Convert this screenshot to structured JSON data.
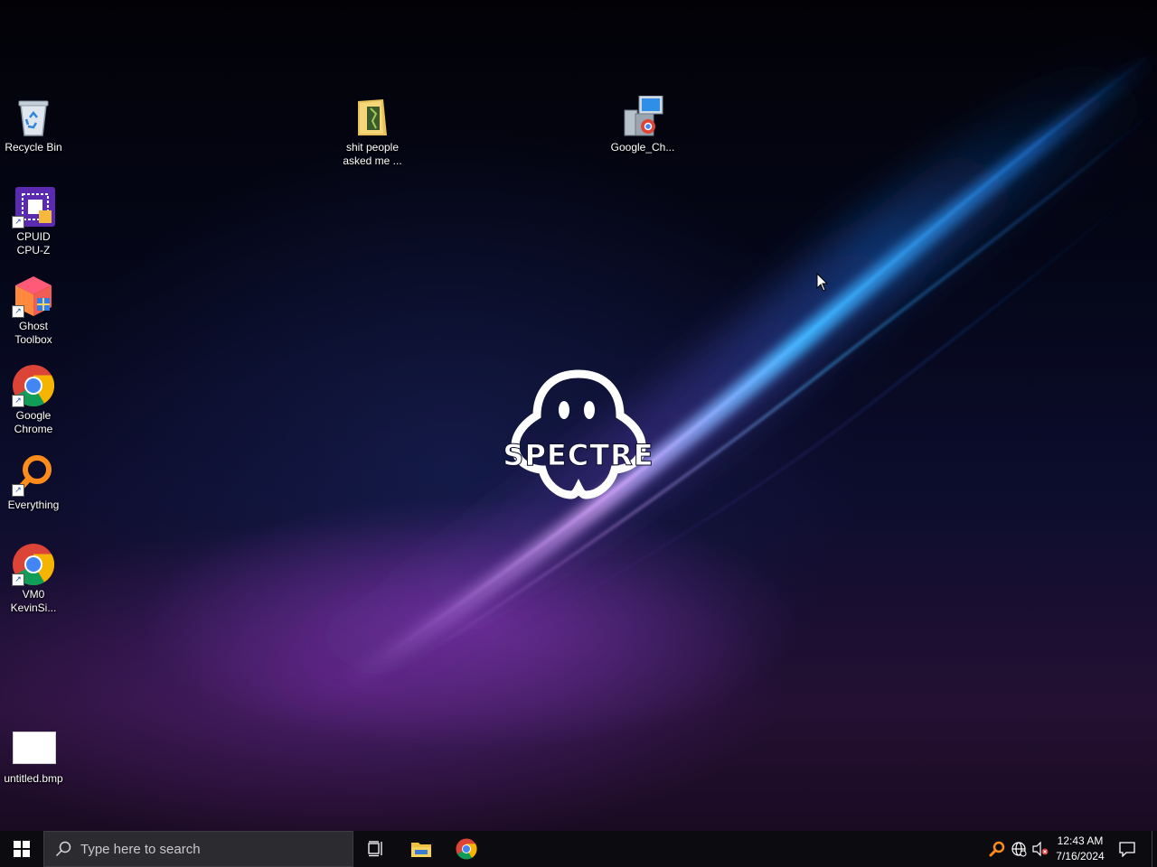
{
  "desktop": {
    "wallpaper_logo_text": "SPECTRE",
    "icons": [
      {
        "label": "Recycle Bin",
        "icon": "recycle-bin-icon"
      },
      {
        "label": "CPUID\nCPU-Z",
        "icon": "cpuz-icon"
      },
      {
        "label": "Ghost\nToolbox",
        "icon": "ghost-toolbox-icon"
      },
      {
        "label": "Google\nChrome",
        "icon": "chrome-icon"
      },
      {
        "label": "Everything",
        "icon": "everything-search-icon"
      },
      {
        "label": "VM0\nKevinSi...",
        "icon": "chrome-icon"
      },
      {
        "label": "untitled.bmp",
        "icon": "bitmap-file-icon"
      },
      {
        "label": "shit people\nasked me ...",
        "icon": "folder-icon"
      },
      {
        "label": "Google_Ch...",
        "icon": "installer-icon"
      }
    ]
  },
  "taskbar": {
    "search_placeholder": "Type here to search",
    "pinned": [
      {
        "name": "task-view",
        "icon": "task-view-icon"
      },
      {
        "name": "file-explorer",
        "icon": "folder-icon"
      },
      {
        "name": "google-chrome",
        "icon": "chrome-icon"
      }
    ],
    "tray": {
      "time": "12:43 AM",
      "date": "7/16/2024"
    }
  },
  "colors": {
    "taskbar_bg": "#0c0c10",
    "search_bg": "#2b2b30",
    "accent_blue": "#2fa6ff"
  }
}
